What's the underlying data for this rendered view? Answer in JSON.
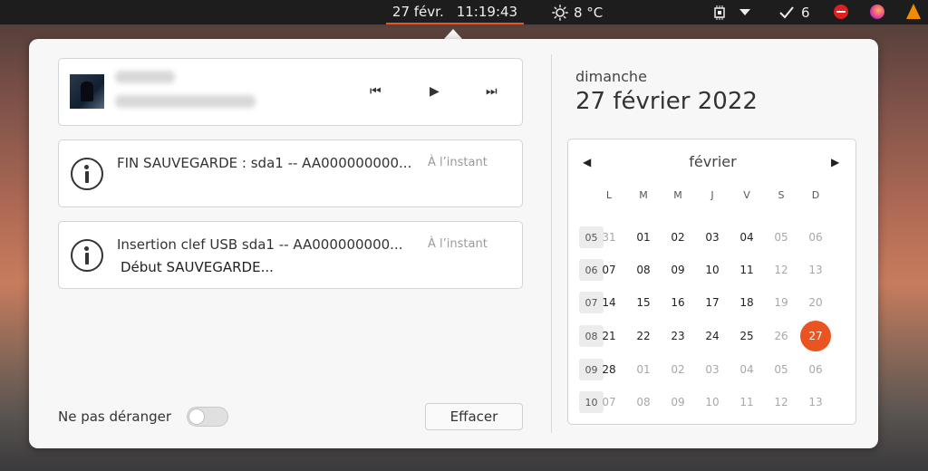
{
  "topbar": {
    "date": "27 févr.",
    "time": "11:19:43",
    "weather_icon": "sun-icon",
    "temperature": "8 °C",
    "update_count": "6"
  },
  "media": {
    "previous_icon": "⏮",
    "play_icon": "▶",
    "next_icon": "⏭"
  },
  "notifications": [
    {
      "title": "FIN SAUVEGARDE : sda1 -- AA000000000...",
      "time": "À l’instant"
    },
    {
      "title": "Insertion clef USB sda1 -- AA000000000...",
      "time": "À l’instant",
      "body": "Début SAUVEGARDE..."
    }
  ],
  "footer": {
    "dnd_label": "Ne pas déranger",
    "dnd_on": false,
    "clear_label": "Effacer"
  },
  "date_panel": {
    "day_name": "dimanche",
    "full_date": "27 février 2022"
  },
  "calendar": {
    "month": "février",
    "prev_icon": "◀",
    "next_icon": "▶",
    "weekdays": [
      "L",
      "M",
      "M",
      "J",
      "V",
      "S",
      "D"
    ],
    "weeks": [
      {
        "num": "05",
        "days": [
          "31",
          "01",
          "02",
          "03",
          "04",
          "05",
          "06"
        ]
      },
      {
        "num": "06",
        "days": [
          "07",
          "08",
          "09",
          "10",
          "11",
          "12",
          "13"
        ]
      },
      {
        "num": "07",
        "days": [
          "14",
          "15",
          "16",
          "17",
          "18",
          "19",
          "20"
        ]
      },
      {
        "num": "08",
        "days": [
          "21",
          "22",
          "23",
          "24",
          "25",
          "26",
          "27"
        ]
      },
      {
        "num": "09",
        "days": [
          "28",
          "01",
          "02",
          "03",
          "04",
          "05",
          "06"
        ]
      },
      {
        "num": "10",
        "days": [
          "07",
          "08",
          "09",
          "10",
          "11",
          "12",
          "13"
        ]
      }
    ],
    "dim_days": [
      [
        0,
        0
      ],
      [
        0,
        5
      ],
      [
        0,
        6
      ],
      [
        1,
        5
      ],
      [
        1,
        6
      ],
      [
        2,
        5
      ],
      [
        2,
        6
      ],
      [
        3,
        5
      ],
      [
        4,
        1
      ],
      [
        4,
        2
      ],
      [
        4,
        3
      ],
      [
        4,
        4
      ],
      [
        4,
        5
      ],
      [
        4,
        6
      ],
      [
        5,
        0
      ],
      [
        5,
        1
      ],
      [
        5,
        2
      ],
      [
        5,
        3
      ],
      [
        5,
        4
      ],
      [
        5,
        5
      ],
      [
        5,
        6
      ]
    ],
    "today": [
      3,
      6
    ],
    "accent": "#e95420"
  }
}
